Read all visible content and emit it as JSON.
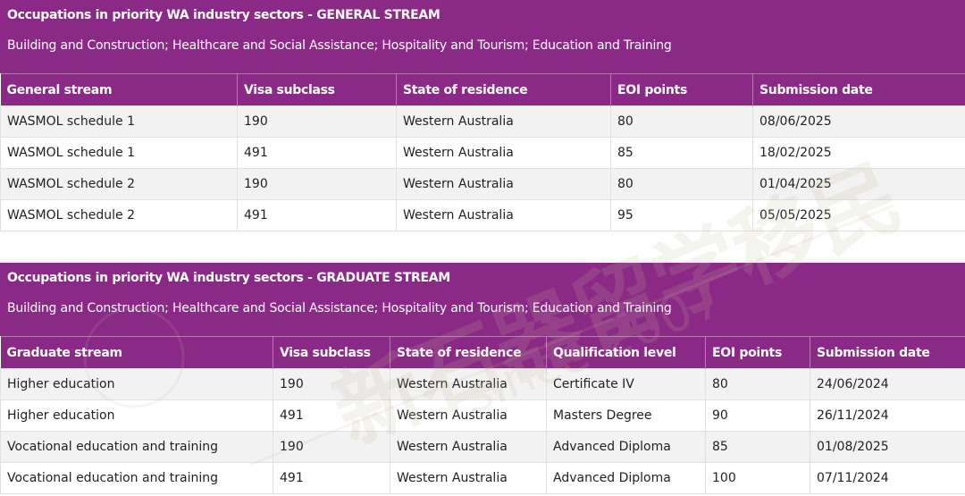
{
  "general": {
    "title": "Occupations in priority WA industry sectors - GENERAL STREAM",
    "subtitle": "Building and Construction; Healthcare and Social Assistance; Hospitality and Tourism; Education and Training",
    "headers": [
      "General stream",
      "Visa subclass",
      "State of residence",
      "EOI points",
      "Submission date"
    ],
    "rows": [
      [
        "WASMOL schedule 1",
        "190",
        "Western Australia",
        "80",
        "08/06/2025"
      ],
      [
        "WASMOL schedule 1",
        "491",
        "Western Australia",
        "85",
        "18/02/2025"
      ],
      [
        "WASMOL schedule 2",
        "190",
        "Western Australia",
        "80",
        "01/04/2025"
      ],
      [
        "WASMOL schedule 2",
        "491",
        "Western Australia",
        "95",
        "05/05/2025"
      ]
    ]
  },
  "graduate": {
    "title": "Occupations in priority WA industry sectors - GRADUATE STREAM",
    "subtitle": "Building and Construction; Healthcare and Social Assistance; Hospitality and Tourism; Education and Training",
    "headers": [
      "Graduate stream",
      "Visa subclass",
      "State of residence",
      "Qualification level",
      "EOI points",
      "Submission date"
    ],
    "rows": [
      [
        "Higher education",
        "190",
        "Western Australia",
        "Certificate IV",
        "80",
        "24/06/2024"
      ],
      [
        "Higher education",
        "491",
        "Western Australia",
        "Masters Degree",
        "90",
        "26/11/2024"
      ],
      [
        "Vocational education and training",
        "190",
        "Western Australia",
        "Advanced Diploma",
        "85",
        "01/08/2025"
      ],
      [
        "Vocational education and training",
        "491",
        "Western Australia",
        "Advanced Diploma",
        "100",
        "07/11/2024"
      ]
    ]
  },
  "watermark": {
    "chinese": "新石器留学移民",
    "english": "since 2007"
  },
  "colors": {
    "banner": "#8a2a86",
    "row_alt": "#f2f2f2"
  }
}
